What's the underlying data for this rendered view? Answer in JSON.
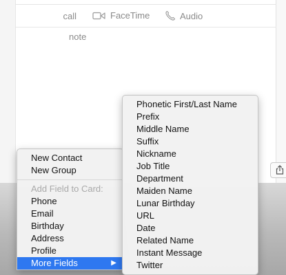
{
  "contact_card": {
    "call_label": "call",
    "facetime_label": "FaceTime",
    "audio_label": "Audio",
    "note_label": "note"
  },
  "main_menu": {
    "items": [
      {
        "label": "New Contact"
      },
      {
        "label": "New Group"
      }
    ],
    "add_field_header": "Add Field to Card:",
    "fields": [
      {
        "label": "Phone"
      },
      {
        "label": "Email"
      },
      {
        "label": "Birthday"
      },
      {
        "label": "Address"
      },
      {
        "label": "Profile"
      }
    ],
    "more_fields": {
      "label": "More Fields",
      "arrow": "▶"
    }
  },
  "sub_menu": {
    "items": [
      {
        "label": "Phonetic First/Last Name"
      },
      {
        "label": "Prefix"
      },
      {
        "label": "Middle Name"
      },
      {
        "label": "Suffix"
      },
      {
        "label": "Nickname"
      },
      {
        "label": "Job Title"
      },
      {
        "label": "Department"
      },
      {
        "label": "Maiden Name"
      },
      {
        "label": "Lunar Birthday"
      },
      {
        "label": "URL"
      },
      {
        "label": "Date"
      },
      {
        "label": "Related Name"
      },
      {
        "label": "Instant Message"
      },
      {
        "label": "Twitter"
      }
    ]
  },
  "colors": {
    "selection": "#2e78f0",
    "label_gray": "#8a8a8a"
  }
}
